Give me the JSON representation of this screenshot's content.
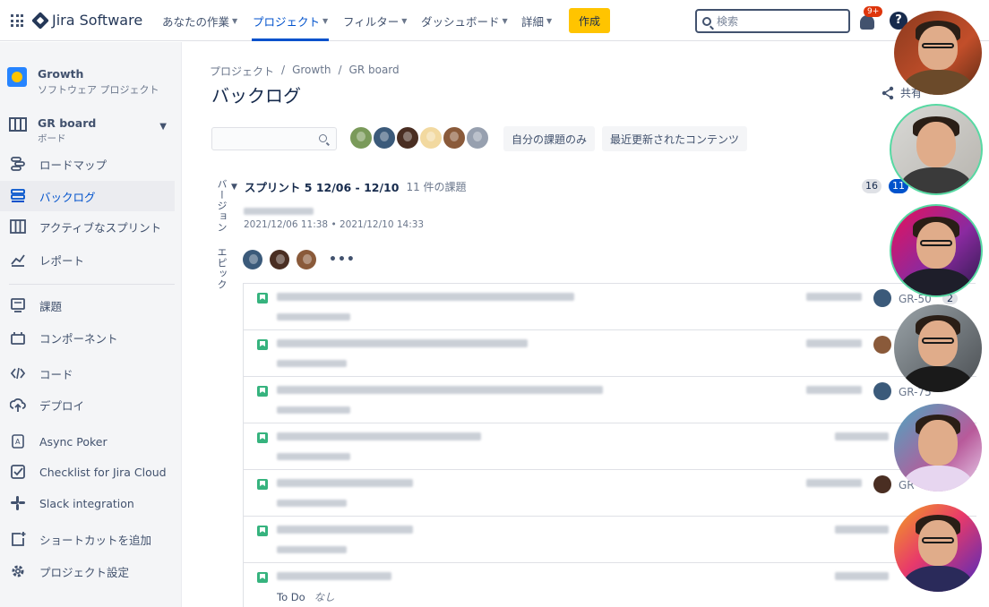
{
  "topnav": {
    "product": "Jira Software",
    "items": [
      {
        "label": "あなたの作業"
      },
      {
        "label": "プロジェクト"
      },
      {
        "label": "フィルター"
      },
      {
        "label": "ダッシュボード"
      },
      {
        "label": "詳細"
      }
    ],
    "create_label": "作成",
    "search_placeholder": "検索",
    "notification_badge": "9+",
    "help_label": "?"
  },
  "sidebar": {
    "project_name": "Growth",
    "project_type": "ソフトウェア プロジェクト",
    "board_name": "GR board",
    "board_sub": "ボード",
    "items": [
      {
        "label": "ロードマップ",
        "icon": "roadmap-icon"
      },
      {
        "label": "バックログ",
        "icon": "backlog-icon"
      },
      {
        "label": "アクティブなスプリント",
        "icon": "board-icon"
      },
      {
        "label": "レポート",
        "icon": "chart-line-icon"
      },
      {
        "label": "課題",
        "icon": "issues-icon"
      },
      {
        "label": "コンポーネント",
        "icon": "component-icon"
      },
      {
        "label": "コード",
        "icon": "code-icon"
      },
      {
        "label": "デプロイ",
        "icon": "cloud-upload-icon"
      },
      {
        "label": "Async Poker",
        "icon": "poker-card-icon"
      },
      {
        "label": "Checklist for Jira Cloud",
        "icon": "checklist-icon"
      },
      {
        "label": "Slack integration",
        "icon": "slack-icon"
      },
      {
        "label": "ショートカットを追加",
        "icon": "add-shortcut-icon"
      },
      {
        "label": "プロジェクト設定",
        "icon": "gear-icon"
      }
    ],
    "selected": "バックログ"
  },
  "breadcrumb": [
    "プロジェクト",
    "Growth",
    "GR board"
  ],
  "page_title": "バックログ",
  "share_label": "共有",
  "quick_filters": [
    "自分の課題のみ",
    "最近更新されたコンテンツ"
  ],
  "vertical_tabs": [
    "バージョン",
    "エピック"
  ],
  "sprint": {
    "title": "スプリント 5 12/06 - 12/10",
    "count": "11 件の課題",
    "dates": "2021/12/06 11:38 • 2021/12/10 14:33",
    "pills": [
      "16",
      "11"
    ]
  },
  "issues": [
    {
      "key": "GR-50",
      "estimate": "2"
    },
    {
      "key": "",
      "estimate": ""
    },
    {
      "key": "GR-75",
      "estimate": ""
    },
    {
      "key": "",
      "estimate": ""
    },
    {
      "key": "GR",
      "estimate": ""
    },
    {
      "key": "",
      "estimate": ""
    },
    {
      "key": "",
      "estimate": "",
      "status": "To Do",
      "epic": "なし"
    }
  ],
  "colors": {
    "brand": "#0052CC",
    "create": "#FFC400",
    "story": "#36B37E",
    "notif": "#DE350B"
  }
}
